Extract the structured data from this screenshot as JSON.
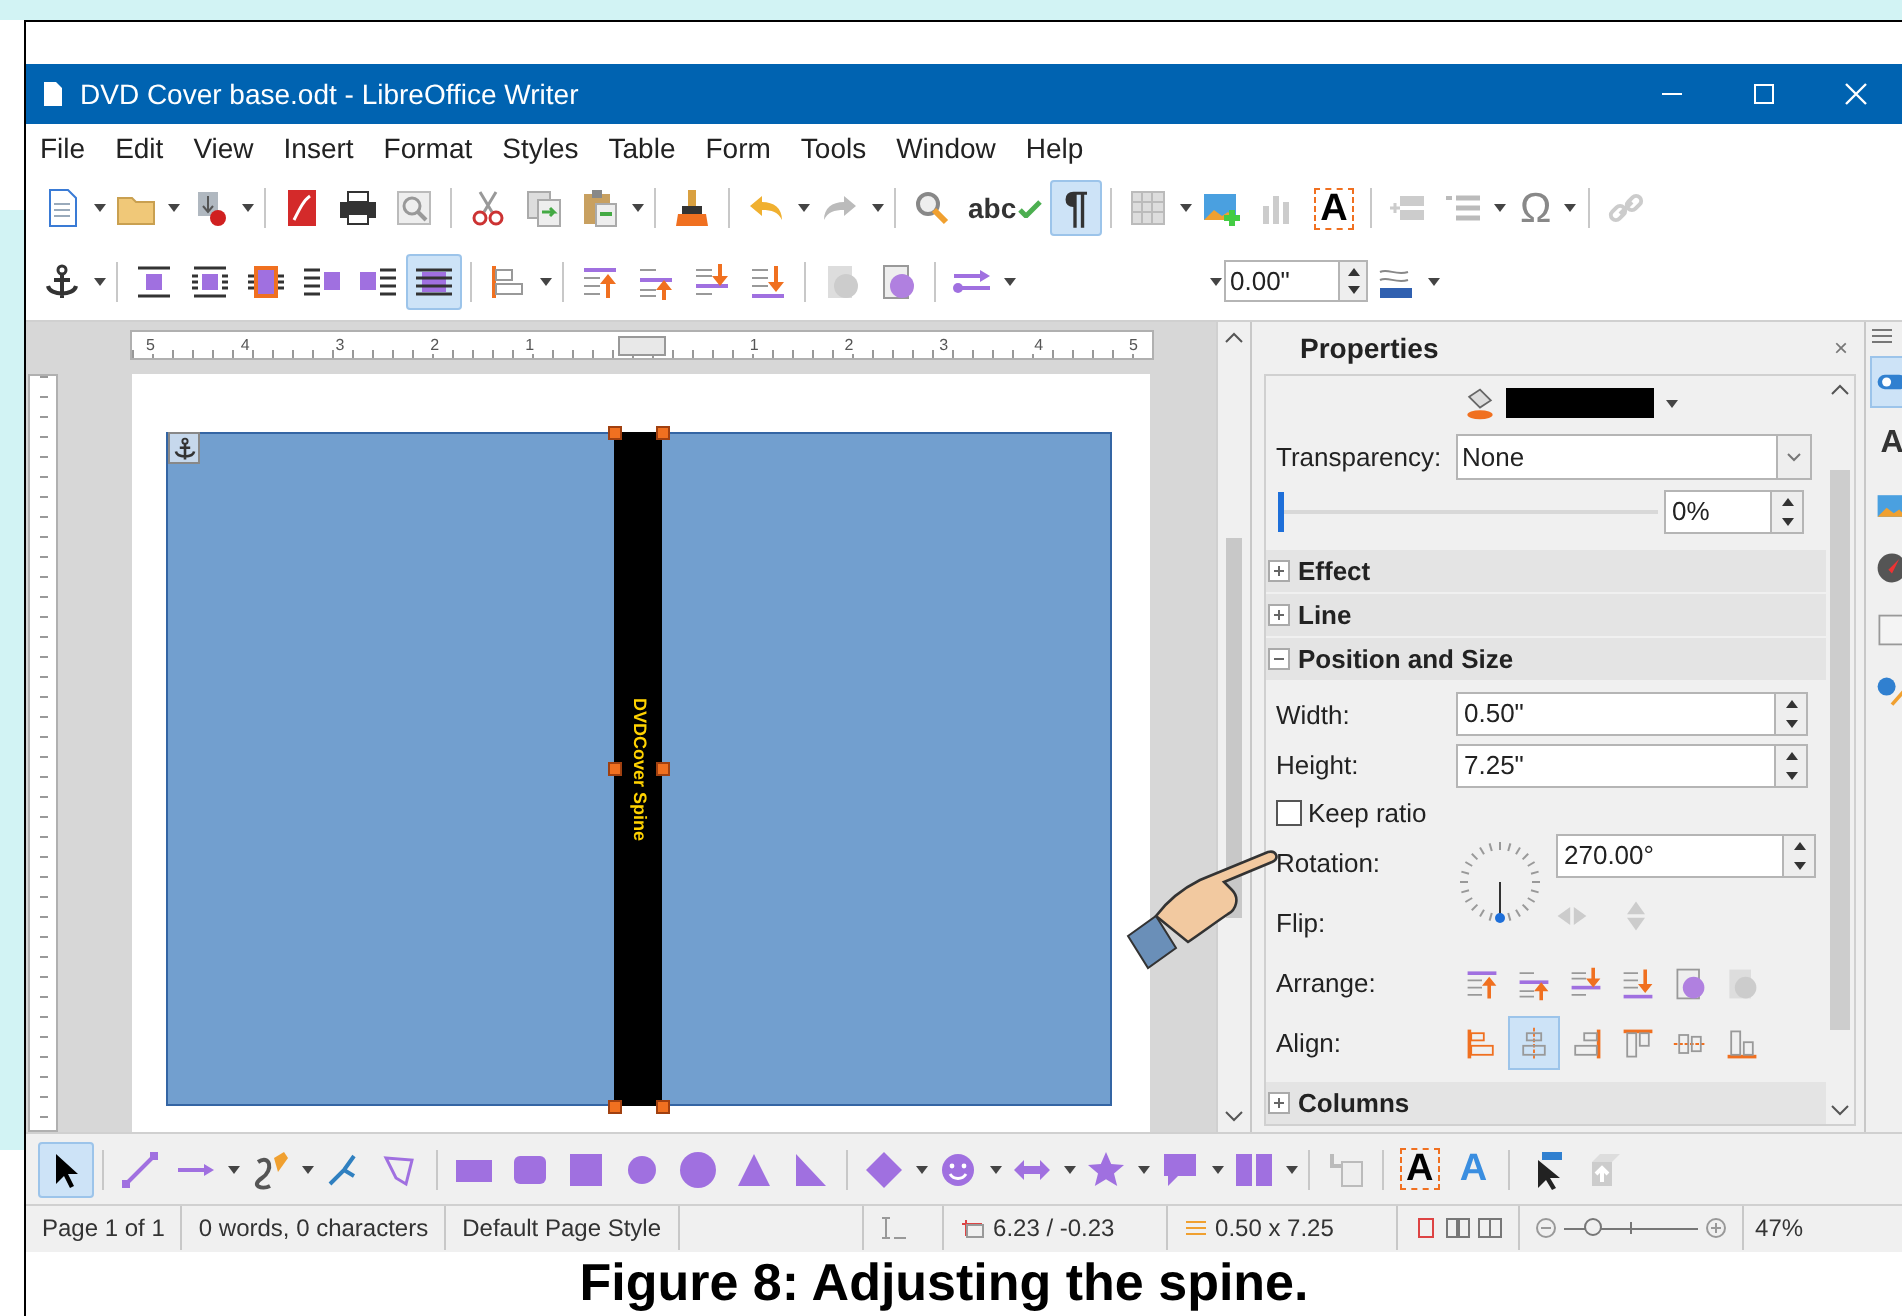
{
  "window": {
    "title": "DVD Cover base.odt - LibreOffice Writer"
  },
  "menu": [
    "File",
    "Edit",
    "View",
    "Insert",
    "Format",
    "Styles",
    "Table",
    "Form",
    "Tools",
    "Window",
    "Help"
  ],
  "standard_toolbar": [
    {
      "kind": "new",
      "selected": false,
      "dropdown": true
    },
    {
      "kind": "open",
      "selected": false,
      "dropdown": true
    },
    {
      "kind": "save",
      "selected": false,
      "dropdown": true
    },
    {
      "kind": "separator"
    },
    {
      "kind": "pdf",
      "selected": false
    },
    {
      "kind": "print",
      "selected": false
    },
    {
      "kind": "preview",
      "selected": false
    },
    {
      "kind": "separator"
    },
    {
      "kind": "cut",
      "selected": false
    },
    {
      "kind": "copy",
      "selected": false
    },
    {
      "kind": "paste",
      "selected": false,
      "dropdown": true
    },
    {
      "kind": "separator"
    },
    {
      "kind": "clone",
      "selected": false
    },
    {
      "kind": "separator"
    },
    {
      "kind": "undo",
      "selected": false,
      "dropdown": true
    },
    {
      "kind": "redo",
      "selected": false,
      "dropdown": true
    },
    {
      "kind": "separator"
    },
    {
      "kind": "find",
      "selected": false
    },
    {
      "kind": "spell",
      "text": "abc",
      "selected": false
    },
    {
      "kind": "marks",
      "text": "¶",
      "selected": true
    },
    {
      "kind": "separator"
    },
    {
      "kind": "table",
      "selected": false,
      "dropdown": true
    },
    {
      "kind": "image",
      "selected": false
    },
    {
      "kind": "chart",
      "selected": false
    },
    {
      "kind": "textbox",
      "text": "A",
      "selected": false
    },
    {
      "kind": "separator"
    },
    {
      "kind": "field",
      "selected": false
    },
    {
      "kind": "list",
      "selected": false,
      "dropdown": true
    },
    {
      "kind": "special",
      "text": "Ω",
      "selected": false,
      "dropdown": true
    },
    {
      "kind": "separator"
    },
    {
      "kind": "link",
      "selected": false
    }
  ],
  "frame_toolbar": [
    {
      "kind": "anchor",
      "selected": false,
      "dropdown": true
    },
    {
      "kind": "separator"
    },
    {
      "kind": "wrap_off",
      "selected": false
    },
    {
      "kind": "wrap_page",
      "selected": false
    },
    {
      "kind": "wrap_optimal",
      "selected": false
    },
    {
      "kind": "wrap_left",
      "selected": false
    },
    {
      "kind": "wrap_right",
      "selected": false
    },
    {
      "kind": "wrap_through",
      "selected": true
    },
    {
      "kind": "separator"
    },
    {
      "kind": "align_obj",
      "selected": false,
      "dropdown": true
    },
    {
      "kind": "separator"
    },
    {
      "kind": "front",
      "selected": false
    },
    {
      "kind": "forward",
      "selected": false
    },
    {
      "kind": "backward",
      "selected": false
    },
    {
      "kind": "back",
      "selected": false
    },
    {
      "kind": "separator"
    },
    {
      "kind": "fg_grey",
      "selected": false
    },
    {
      "kind": "background",
      "selected": false
    },
    {
      "kind": "separator"
    },
    {
      "kind": "line_arrow",
      "selected": false,
      "dropdown": true
    },
    {
      "kind": "style_field"
    },
    {
      "kind": "width_field",
      "value": "0.00\""
    },
    {
      "kind": "line_color",
      "selected": false,
      "dropdown": true
    }
  ],
  "ruler": [
    "5",
    "4",
    "3",
    "2",
    "1",
    "1",
    "2",
    "3",
    "4",
    "5"
  ],
  "document": {
    "spine_text": "DVDCover Spine"
  },
  "sidebar": {
    "title": "Properties",
    "close": "×",
    "transparency": {
      "label": "Transparency:",
      "value": "None"
    },
    "transparency_slider": {
      "level": 0,
      "value": "0%"
    },
    "sections": [
      {
        "title": "Effect",
        "expanded": false
      },
      {
        "title": "Line",
        "expanded": false
      },
      {
        "title": "Position and Size",
        "expanded": true
      },
      {
        "title": "Columns",
        "expanded": false
      }
    ],
    "width": {
      "label": "Width:",
      "value": "0.50\""
    },
    "height": {
      "label": "Height:",
      "value": "7.25\""
    },
    "keep_ratio": {
      "label": "Keep ratio",
      "checked": false
    },
    "rotation": {
      "label": "Rotation:",
      "value": "270.00°"
    },
    "flip": {
      "label": "Flip:"
    },
    "arrange": {
      "label": "Arrange:"
    },
    "align": {
      "label": "Align:",
      "buttons": [
        {
          "kind": "a_left",
          "selected": false
        },
        {
          "kind": "a_center",
          "selected": true
        },
        {
          "kind": "a_right",
          "selected": false
        },
        {
          "kind": "a_top",
          "selected": false
        },
        {
          "kind": "a_middle",
          "selected": false
        },
        {
          "kind": "a_bottom",
          "selected": false
        }
      ]
    }
  },
  "sidebar_tabs": [
    {
      "kind": "properties",
      "selected": true
    },
    {
      "kind": "styles",
      "text": "A",
      "selected": false
    },
    {
      "kind": "gallery",
      "selected": false
    },
    {
      "kind": "navigator",
      "selected": false
    },
    {
      "kind": "page",
      "selected": false
    },
    {
      "kind": "changes",
      "selected": false
    }
  ],
  "drawing_toolbar": [
    {
      "kind": "select",
      "selected": true
    },
    {
      "kind": "separator"
    },
    {
      "kind": "line",
      "selected": false
    },
    {
      "kind": "arrow_line",
      "selected": false,
      "dropdown": true
    },
    {
      "kind": "curve",
      "selected": false,
      "dropdown": true
    },
    {
      "kind": "points",
      "selected": false
    },
    {
      "kind": "polygon",
      "selected": false
    },
    {
      "kind": "separator"
    },
    {
      "kind": "rect",
      "selected": false
    },
    {
      "kind": "rounded",
      "selected": false
    },
    {
      "kind": "square",
      "selected": false
    },
    {
      "kind": "circle",
      "selected": false
    },
    {
      "kind": "ellipse",
      "selected": false
    },
    {
      "kind": "triangle",
      "selected": false
    },
    {
      "kind": "right_triangle",
      "selected": false
    },
    {
      "kind": "separator"
    },
    {
      "kind": "diamond",
      "selected": false,
      "dropdown": true
    },
    {
      "kind": "smiley",
      "selected": false,
      "dropdown": true
    },
    {
      "kind": "double_arrow",
      "selected": false,
      "dropdown": true
    },
    {
      "kind": "star",
      "selected": false,
      "dropdown": true
    },
    {
      "kind": "callout",
      "selected": false,
      "dropdown": true
    },
    {
      "kind": "flowchart",
      "selected": false,
      "dropdown": true
    },
    {
      "kind": "separator"
    },
    {
      "kind": "text_wrap",
      "selected": false
    },
    {
      "kind": "separator"
    },
    {
      "kind": "fontwork",
      "text": "A",
      "selected": false
    },
    {
      "kind": "fontwork_blue",
      "text": "A",
      "selected": false
    },
    {
      "kind": "separator"
    },
    {
      "kind": "pointer",
      "selected": false
    },
    {
      "kind": "extrusion",
      "selected": false
    }
  ],
  "status_bar": {
    "page": "Page 1 of 1",
    "words": "0 words, 0 characters",
    "page_style": "Default Page Style",
    "position": "6.23 / -0.23",
    "size": "0.50 x 7.25",
    "zoom_slider": {
      "level": 0.15
    },
    "zoom": "47%"
  },
  "caption": "Figure 8: Adjusting the spine."
}
